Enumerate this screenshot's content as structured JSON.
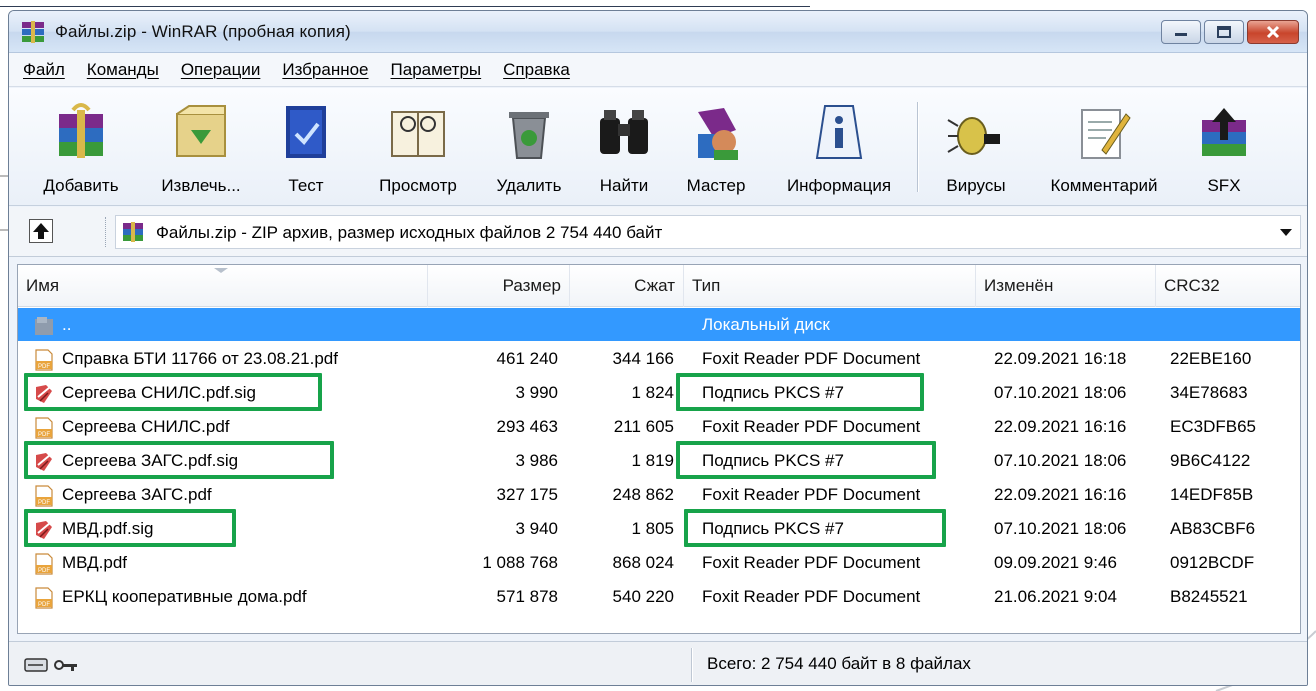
{
  "window": {
    "title": "Файлы.zip - WinRAR (пробная копия)"
  },
  "menu": [
    "Файл",
    "Команды",
    "Операции",
    "Избранное",
    "Параметры",
    "Справка"
  ],
  "toolbar": [
    {
      "label": "Добавить",
      "icon": "add-archive-icon"
    },
    {
      "label": "Извлечь...",
      "icon": "extract-icon"
    },
    {
      "label": "Тест",
      "icon": "test-icon"
    },
    {
      "label": "Просмотр",
      "icon": "view-icon"
    },
    {
      "label": "Удалить",
      "icon": "delete-icon"
    },
    {
      "label": "Найти",
      "icon": "find-binoculars-icon"
    },
    {
      "label": "Мастер",
      "icon": "wizard-icon"
    },
    {
      "label": "Информация",
      "icon": "info-icon"
    },
    {
      "label": "Вирусы",
      "icon": "virus-scan-icon"
    },
    {
      "label": "Комментарий",
      "icon": "comment-icon"
    },
    {
      "label": "SFX",
      "icon": "sfx-icon"
    }
  ],
  "address": {
    "text": "Файлы.zip - ZIP архив, размер исходных файлов 2 754 440 байт"
  },
  "columns": [
    "Имя",
    "Размер",
    "Сжат",
    "Тип",
    "Изменён",
    "CRC32"
  ],
  "rows": [
    {
      "name": "..",
      "size": "",
      "packed": "",
      "type": "Локальный диск",
      "modified": "",
      "crc": "",
      "icon": "folder-up-icon",
      "selected": true
    },
    {
      "name": "Справка БТИ 11766 от 23.08.21.pdf",
      "size": "461 240",
      "packed": "344 166",
      "type": "Foxit Reader PDF Document",
      "modified": "22.09.2021 16:18",
      "crc": "22EBE160",
      "icon": "pdf-icon"
    },
    {
      "name": "Сергеева СНИЛС.pdf.sig",
      "size": "3 990",
      "packed": "1 824",
      "type": "Подпись PKCS #7",
      "modified": "07.10.2021 18:06",
      "crc": "34E78683",
      "icon": "signature-icon"
    },
    {
      "name": "Сергеева СНИЛС.pdf",
      "size": "293 463",
      "packed": "211 605",
      "type": "Foxit Reader PDF Document",
      "modified": "22.09.2021 16:16",
      "crc": "EC3DFB65",
      "icon": "pdf-icon"
    },
    {
      "name": "Сергеева ЗАГС.pdf.sig",
      "size": "3 986",
      "packed": "1 819",
      "type": "Подпись PKCS #7",
      "modified": "07.10.2021 18:06",
      "crc": "9B6C4122",
      "icon": "signature-icon"
    },
    {
      "name": "Сергеева ЗАГС.pdf",
      "size": "327 175",
      "packed": "248 862",
      "type": "Foxit Reader PDF Document",
      "modified": "22.09.2021 16:16",
      "crc": "14EDF85B",
      "icon": "pdf-icon"
    },
    {
      "name": "МВД.pdf.sig",
      "size": "3 940",
      "packed": "1 805",
      "type": "Подпись PKCS #7",
      "modified": "07.10.2021 18:06",
      "crc": "AB83CBF6",
      "icon": "signature-icon"
    },
    {
      "name": "МВД.pdf",
      "size": "1 088 768",
      "packed": "868 024",
      "type": "Foxit Reader PDF Document",
      "modified": "09.09.2021 9:46",
      "crc": "0912BCDF",
      "icon": "pdf-icon"
    },
    {
      "name": "ЕРКЦ кооперативные дома.pdf",
      "size": "571 878",
      "packed": "540 220",
      "type": "Foxit Reader PDF Document",
      "modified": "21.06.2021 9:04",
      "crc": "B8245521",
      "icon": "pdf-icon"
    }
  ],
  "status": {
    "text": "Всего: 2 754 440 байт в 8 файлах"
  },
  "colors": {
    "selection": "#3399ff",
    "highlight_box": "#17a34a"
  }
}
